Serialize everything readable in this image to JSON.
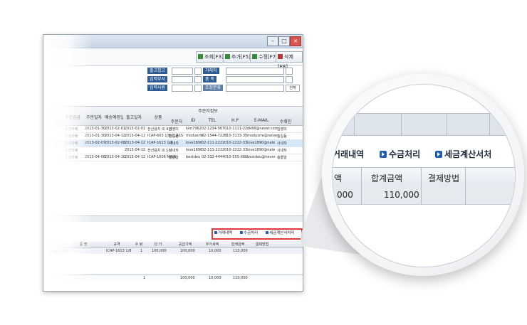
{
  "toolbar": {
    "buttons": [
      "조회[F3]",
      "추가[F5]",
      "수정[F7]",
      "삭제[F8]"
    ]
  },
  "form": {
    "labels": [
      "출고창고",
      "거래처",
      "입력부서",
      "품 목",
      "입력사원"
    ],
    "second_label": "조정분류",
    "select_value": "전체"
  },
  "grid": {
    "group_header": "주문자정보",
    "headers": [
      "세금명",
      "주문입금",
      "주문일자",
      "배송예정일",
      "출고일자",
      "상품",
      "주문자",
      "ID",
      "TEL",
      "H.P",
      "E-MAIL",
      "수취인"
    ],
    "rows": [
      [
        "운영자배",
        "2013-01-30",
        "2013-02-01",
        "2013-02-01",
        "전산용지 외 4건",
        "김영미",
        "kim7962",
        "02-1234-567",
        "010-1111-22",
        "dk66@never.com",
        "김영미"
      ],
      [
        "운영자배",
        "2013-01-30",
        "2013-04-12",
        "2013-04-12",
        "ICAP-603 1/8 CLASS",
        "홍길동",
        "moduerre",
        "02-1544-7223",
        "010-3133-30",
        "modusrre@never",
        "홍길동"
      ],
      [
        "운영자배",
        "2013-02-07",
        "2013-02-08",
        "2013-04-12",
        "ICAP-1613 1/8",
        "사내자",
        "love1890",
        "02-111-2222",
        "010-2222-33",
        "love1890@nate",
        "사내자"
      ],
      [
        "운영자배",
        "",
        "",
        "2013-04-12",
        "전산용지 외 1건",
        "사내자",
        "love1890",
        "02-111-2222",
        "010-2222-33",
        "love1890@nate",
        "사내자"
      ],
      [
        "운영자배",
        "2013-04-08",
        "2013-04-10",
        "2013-04-12",
        "ICAP-1606 MAIN",
        "홍물알",
        "bestdeu",
        "02-333-4444",
        "010-555-666",
        "bestdeu@never",
        "홍물알"
      ]
    ]
  },
  "actions": [
    "거래내역",
    "수금처리",
    "세금계산서처리"
  ],
  "lower_grid": {
    "headers": [
      "품 명",
      "규격",
      "수 량",
      "단 가",
      "공급가액",
      "부가세액",
      "합계금액",
      "결제방법"
    ],
    "row": [
      "전산용지 1/8",
      "ICAP-1613 1/8",
      "1",
      "100,000",
      "100,000",
      "10,000",
      "110,000",
      ""
    ],
    "totals": [
      "1",
      "100,000",
      "10,000",
      "110,000"
    ]
  },
  "magnifier": {
    "buttons": [
      "거래내역",
      "수금처리",
      "세금계산서처"
    ],
    "headers": [
      "액",
      "합계금액",
      "결제방법"
    ],
    "values": [
      "000",
      "110,000",
      ""
    ]
  },
  "colors": {
    "label_blue": "#2f5b93",
    "highlight_red": "#e03b3b",
    "button_blue": "#1f5fb2"
  }
}
